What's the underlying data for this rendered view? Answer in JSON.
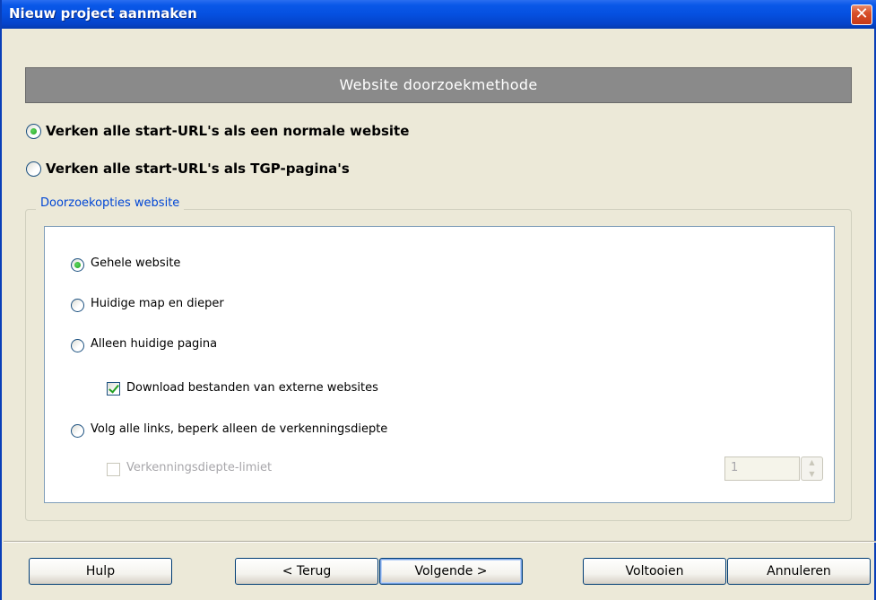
{
  "window": {
    "title": "Nieuw project aanmaken",
    "close_glyph": "✕"
  },
  "banner": {
    "title": "Website doorzoekmethode"
  },
  "mode_options": [
    {
      "label": "Verken alle start-URL's als een normale website",
      "selected": true
    },
    {
      "label": "Verken alle start-URL's als TGP-pagina's",
      "selected": false
    }
  ],
  "group": {
    "title": "Doorzoekopties website"
  },
  "scope_options": [
    {
      "label": "Gehele website",
      "selected": true
    },
    {
      "label": "Huidige map en dieper",
      "selected": false
    },
    {
      "label": "Alleen huidige pagina",
      "selected": false
    },
    {
      "label": "Volg alle links, beperk alleen de verkenningsdiepte",
      "selected": false
    }
  ],
  "external_download": {
    "label": "Download bestanden van externe websites",
    "checked": true
  },
  "depth_limit": {
    "label": "Verkenningsdiepte-limiet",
    "checked": false,
    "enabled": false,
    "value": "1"
  },
  "buttons": {
    "help": "Hulp",
    "back": "< Terug",
    "next": "Volgende >",
    "finish": "Voltooien",
    "cancel": "Annuleren"
  },
  "icons": {
    "spin_up": "▲",
    "spin_down": "▼"
  }
}
